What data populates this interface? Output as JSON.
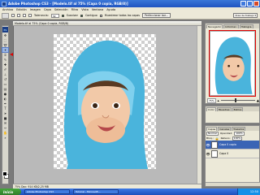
{
  "window": {
    "title": "Adobe Photoshop CS3 - [Modelo.tif al 75% (Capa 0 copia, RGB/8)]"
  },
  "menu": [
    "Archivo",
    "Edición",
    "Imagen",
    "Capa",
    "Selección",
    "Filtro",
    "Vista",
    "Ventana",
    "Ayuda"
  ],
  "options_bar": {
    "tolerance_label": "Tolerancia:",
    "tolerance_value": "32",
    "antialias_label": "Suavizar",
    "contiguous_label": "Contiguo",
    "sample_all_label": "Muestrear todas las capas",
    "refine_label": "Perfeccionar bor..."
  },
  "workspace_label": "Área de trabajo ▾",
  "document": {
    "title": "Modelo.tif al 75% (Capa 0 copia, RGB/8)",
    "status": "75%   Doc: 914 KB/2,25 MB"
  },
  "navigator": {
    "tabs": [
      "Navegador",
      "Informac.",
      "Histogra."
    ],
    "zoom": "75%"
  },
  "mid_panel": {
    "tabs": [
      "Color",
      "Muestras",
      "Estilos"
    ]
  },
  "layers": {
    "tabs": [
      "Capas",
      "Canales",
      "Trazados"
    ],
    "blend_mode": "Normal",
    "opacity_label": "Opacidad:",
    "opacity": "100%",
    "lock_label": "Bloq.:",
    "fill_label": "Relleno:",
    "fill": "100%",
    "items": [
      {
        "name": "Capa 0 copia",
        "selected": true
      },
      {
        "name": "Capa 0",
        "selected": false
      }
    ]
  },
  "taskbar": {
    "start": "Inicio",
    "items": [
      "Adobe Photoshop CS3",
      "Tutorial - Microsoft..."
    ],
    "clock": "12:50"
  },
  "colors": {
    "accent": "#3a64b5",
    "selection_red": "#e00000",
    "hood": "#4ab4dc"
  }
}
